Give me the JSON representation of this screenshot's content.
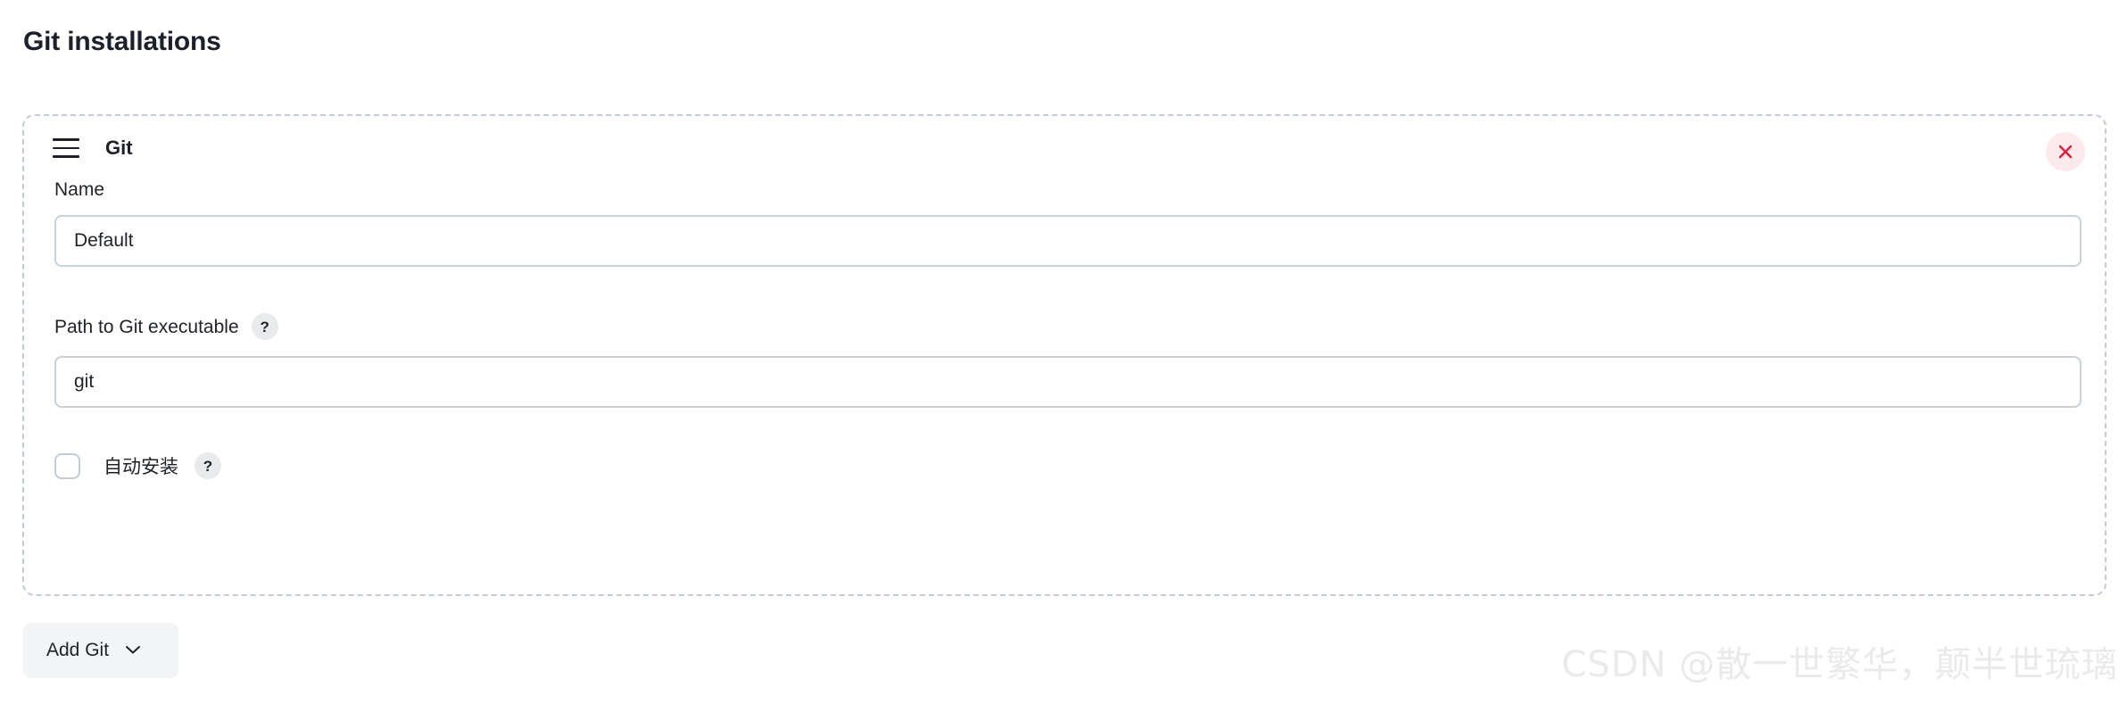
{
  "page": {
    "title": "Git installations"
  },
  "card": {
    "drag_handle_icon": "hamburger-drag-icon",
    "title": "Git",
    "close_icon": "close-x-icon",
    "close_icon_color": "#e01e37",
    "close_bg_color": "#fdeaec",
    "border_color": "#c3ccd6"
  },
  "fields": {
    "name": {
      "label": "Name",
      "value": "Default",
      "placeholder": ""
    },
    "path": {
      "label": "Path to Git executable",
      "value": "git",
      "placeholder": "",
      "help_icon": "question-mark-icon",
      "help_label": "?"
    },
    "auto_install": {
      "label": "自动安装",
      "checked": false,
      "help_icon": "question-mark-icon",
      "help_label": "?"
    }
  },
  "actions": {
    "add_git": {
      "label": "Add Git",
      "chevron_icon": "chevron-down-icon"
    }
  },
  "watermark": {
    "text": "CSDN @散一世繁华，颠半世琉璃"
  }
}
